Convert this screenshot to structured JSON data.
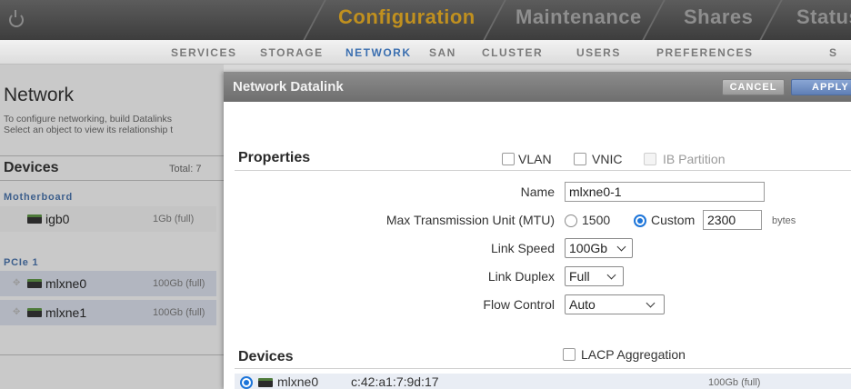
{
  "topnav": {
    "tabs": [
      {
        "label": "Configuration",
        "active": true
      },
      {
        "label": "Maintenance",
        "active": false
      },
      {
        "label": "Shares",
        "active": false
      },
      {
        "label": "Status",
        "active": false
      }
    ]
  },
  "subnav": {
    "items": [
      "SERVICES",
      "STORAGE",
      "NETWORK",
      "SAN",
      "CLUSTER",
      "USERS",
      "PREFERENCES",
      "S"
    ],
    "active": "NETWORK"
  },
  "left_panel": {
    "title": "Network",
    "description_line1": "To configure networking, build Datalinks",
    "description_line2": "Select an object to view its relationship t",
    "devices_heading": "Devices",
    "total_label": "Total: 7",
    "groups": [
      {
        "name": "Motherboard",
        "devices": [
          {
            "name": "igb0",
            "speed": "1Gb (full)"
          }
        ]
      },
      {
        "name": "PCIe 1",
        "devices": [
          {
            "name": "mlxne0",
            "speed": "100Gb (full)"
          },
          {
            "name": "mlxne1",
            "speed": "100Gb (full)"
          }
        ]
      }
    ]
  },
  "modal": {
    "title": "Network Datalink",
    "cancel_label": "CANCEL",
    "apply_label": "APPLY",
    "properties": {
      "heading": "Properties",
      "vlan_label": "VLAN",
      "vnic_label": "VNIC",
      "ib_partition_label": "IB Partition",
      "name_label": "Name",
      "name_value": "mlxne0-1",
      "mtu_label": "Max Transmission Unit (MTU)",
      "mtu_option_1500": "1500",
      "mtu_option_custom": "Custom",
      "mtu_custom_value": "2300",
      "mtu_unit": "bytes",
      "link_speed_label": "Link Speed",
      "link_speed_value": "100Gb",
      "link_duplex_label": "Link Duplex",
      "link_duplex_value": "Full",
      "flow_control_label": "Flow Control",
      "flow_control_value": "Auto"
    },
    "devices": {
      "heading": "Devices",
      "lacp_label": "LACP Aggregation",
      "rows": [
        {
          "name": "mlxne0",
          "mac": "c:42:a1:7:9d:17",
          "speed": "100Gb (full)",
          "selected": true
        }
      ]
    }
  },
  "colors": {
    "active_tab": "#c0901f",
    "active_subnav": "#3b6fb0",
    "radio_on": "#1d75d9"
  }
}
